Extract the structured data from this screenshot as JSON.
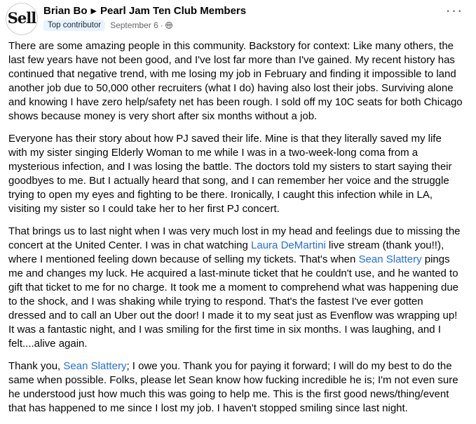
{
  "author": {
    "name": "Brian Bo",
    "avatar_text": "Sell",
    "badge": "Top contributor"
  },
  "group": {
    "name": "Pearl Jam Ten Club Members"
  },
  "arrow_icon": "right-triangle",
  "meta": {
    "date": "September 6",
    "separator": "·",
    "privacy_icon": "globe-icon"
  },
  "more_icon": "more-options-icon",
  "post": {
    "p1": "There are some amazing people in this community. Backstory for context: Like many others, the last few years have not been good, and I've lost far more than I've gained. My recent history has continued that negative trend, with me losing my job in February and finding it impossible to land another job due to 50,000 other recruiters (what I do) having also lost their jobs. Surviving alone and knowing I have zero help/safety net has been rough. I sold off my 10C seats for both Chicago shows because money is very short after six months without a job.",
    "p2": "Everyone has their story about how PJ saved their life. Mine is that they literally saved my life with my sister singing Elderly Woman to me while I was in a two-week-long coma from a mysterious infection, and I was losing the battle. The doctors told my sisters to start saying their goodbyes to me. But I actually heard that song, and I can remember her voice and the struggle trying to open my eyes and fighting to be there. Ironically, I caught this infection while in LA, visiting my sister so I could take her to her first PJ concert.",
    "p3_a": "That brings us to last night when I was very much lost in my head and feelings due to missing the concert at the United Center. I was in chat watching ",
    "p3_mention1": "Laura DeMartini",
    "p3_b": " live stream (thank you!!), where I mentioned feeling down because of selling my tickets. That's when ",
    "p3_mention2": "Sean Slattery",
    "p3_c": " pings me and changes my luck. He acquired a last-minute ticket that he couldn't use, and he wanted to gift that ticket to me for no charge. It took me a moment to comprehend what was happening due to the shock, and I was shaking while trying to respond. That's the fastest I've ever gotten dressed and to call an Uber out the door! I made it to my seat just as Evenflow was wrapping up! It was a fantastic night, and I was smiling for the first time in six months. I was laughing, and I felt....alive again.",
    "p4_a": "Thank you, ",
    "p4_mention": "Sean Slattery",
    "p4_b": "; I owe you. Thank you for paying it forward; I will do my best to do the same when possible. Folks, please let Sean know how fucking incredible he is; I'm not even sure he understood just how much this was going to help me. This is the first good news/thing/event that has happened to me since I lost my job. I haven't stopped smiling since last night."
  },
  "colors": {
    "mention": "#216fdb",
    "meta": "#65676b",
    "badge_bg": "#e7f3ff"
  }
}
